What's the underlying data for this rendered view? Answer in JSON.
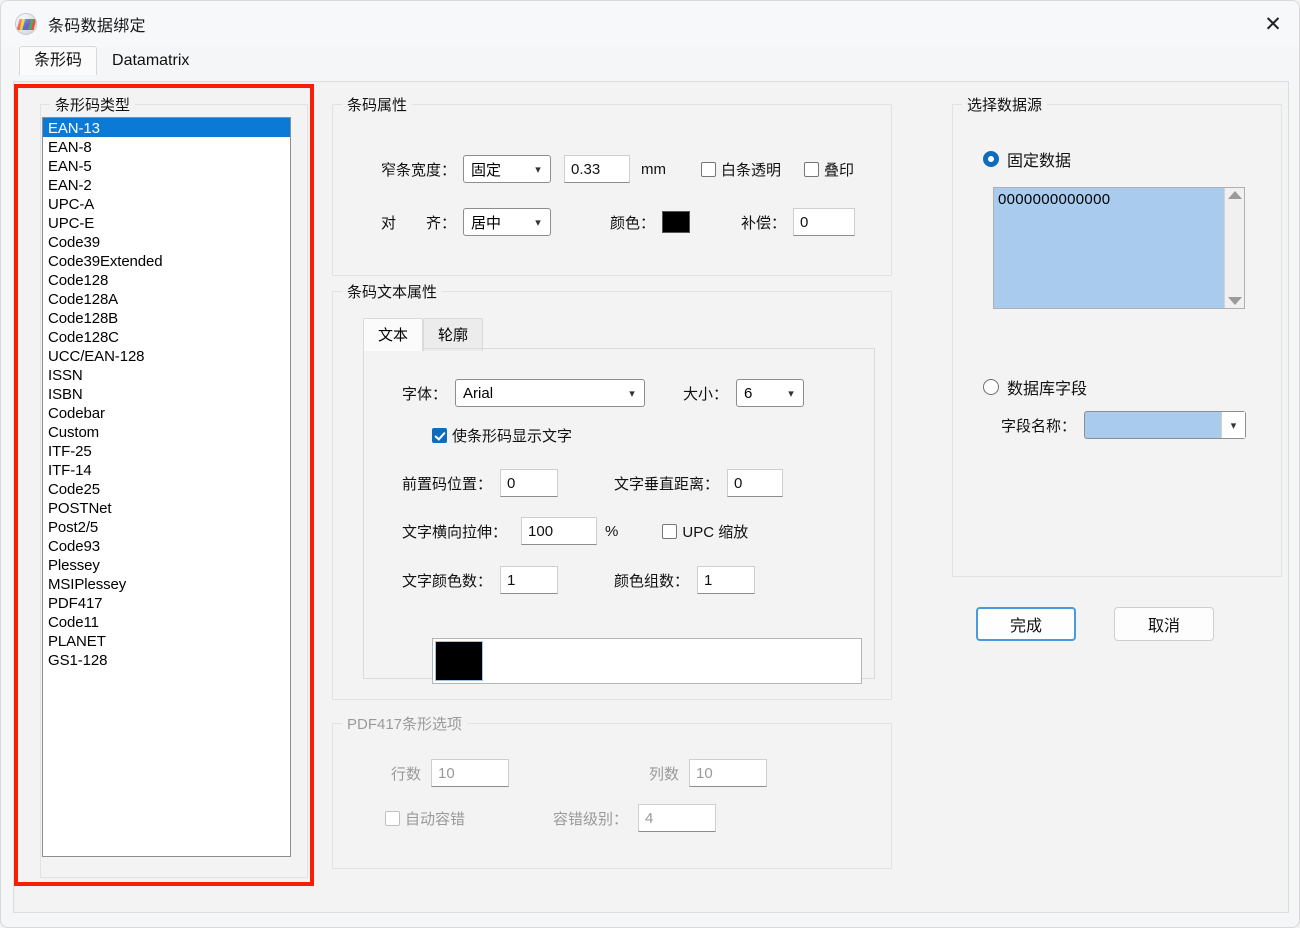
{
  "window": {
    "title": "条码数据绑定",
    "icon": "app-barcode-icon",
    "close_label": "✕"
  },
  "tabs": [
    {
      "label": "条形码",
      "active": true
    },
    {
      "label": "Datamatrix",
      "active": false
    }
  ],
  "barcode_type": {
    "legend": "条形码类型",
    "selected": "EAN-13",
    "options": [
      "EAN-13",
      "EAN-8",
      "EAN-5",
      "EAN-2",
      "UPC-A",
      "UPC-E",
      "Code39",
      "Code39Extended",
      "Code128",
      "Code128A",
      "Code128B",
      "Code128C",
      "UCC/EAN-128",
      "ISSN",
      "ISBN",
      "Codebar",
      "Custom",
      "ITF-25",
      "ITF-14",
      "Code25",
      "POSTNet",
      "Post2/5",
      "Code93",
      "Plessey",
      "MSIPlessey",
      "PDF417",
      "Code11",
      "PLANET",
      "GS1-128"
    ]
  },
  "barcode_attrs": {
    "legend": "条码属性",
    "narrow_width_label": "窄条宽度：",
    "narrow_width_mode": "固定",
    "narrow_width_value": "0.33",
    "unit": "mm",
    "white_bar_transparent_label": "白条透明",
    "white_bar_transparent_checked": false,
    "overprint_label": "叠印",
    "overprint_checked": false,
    "align_label": "对　　齐：",
    "align_value": "居中",
    "color_label": "颜色：",
    "color_value": "#000000",
    "compensation_label": "补偿：",
    "compensation_value": "0"
  },
  "text_attrs": {
    "legend": "条码文本属性",
    "inner_tabs": [
      {
        "label": "文本",
        "active": true
      },
      {
        "label": "轮廓",
        "active": false
      }
    ],
    "font_label": "字体：",
    "font_value": "Arial",
    "size_label": "大小：",
    "size_value": "6",
    "show_text_label": "使条形码显示文字",
    "show_text_checked": true,
    "prefix_pos_label": "前置码位置：",
    "prefix_pos_value": "0",
    "text_vertical_label": "文字垂直距离：",
    "text_vertical_value": "0",
    "text_stretch_label": "文字横向拉伸：",
    "text_stretch_value": "100",
    "percent": "%",
    "upc_scale_label": "UPC 缩放",
    "upc_scale_checked": false,
    "text_color_count_label": "文字颜色数：",
    "text_color_count_value": "1",
    "color_group_count_label": "颜色组数：",
    "color_group_count_value": "1",
    "color_chip": "#000000"
  },
  "pdf417": {
    "legend": "PDF417条形选项",
    "disabled": true,
    "rows_label": "行数",
    "rows_value": "10",
    "cols_label": "列数",
    "cols_value": "10",
    "auto_ec_label": "自动容错",
    "auto_ec_checked": false,
    "ec_level_label": "容错级别：",
    "ec_level_value": "4"
  },
  "data_source": {
    "legend": "选择数据源",
    "fixed_label": "固定数据",
    "fixed_selected": true,
    "fixed_value": "0000000000000",
    "db_field_label": "数据库字段",
    "db_field_selected": false,
    "field_name_label": "字段名称：",
    "field_name_value": ""
  },
  "footer": {
    "ok_label": "完成",
    "cancel_label": "取消"
  },
  "annotation": {
    "color": "#f81d05"
  }
}
